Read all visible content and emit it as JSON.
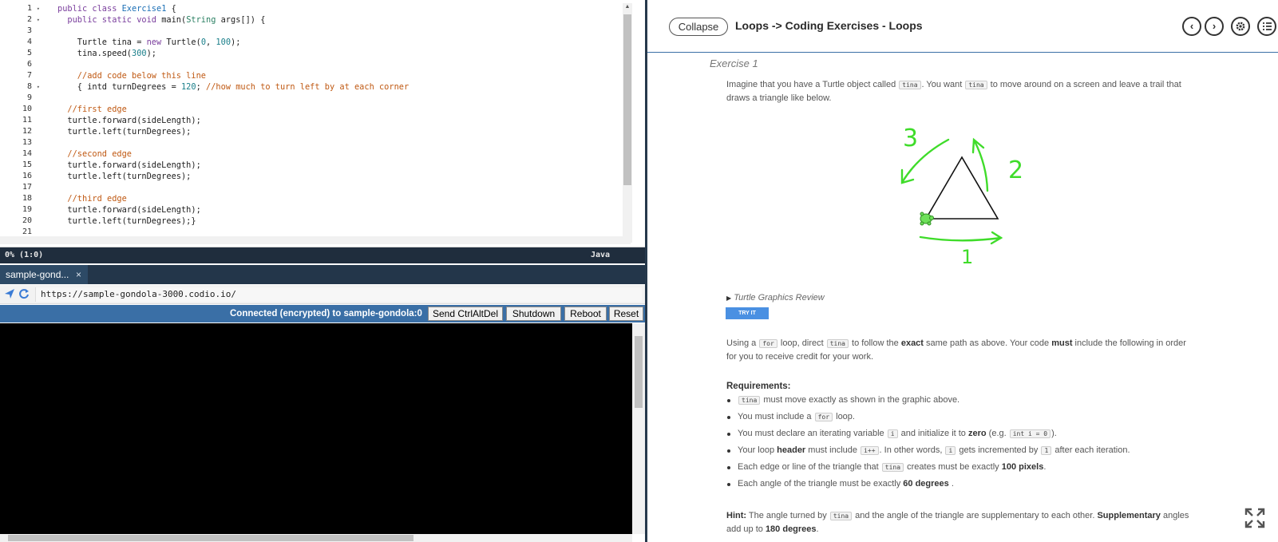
{
  "editor": {
    "lines": [
      {
        "n": "1",
        "fold": true
      },
      {
        "n": "2",
        "fold": true
      },
      {
        "n": "3"
      },
      {
        "n": "4"
      },
      {
        "n": "5"
      },
      {
        "n": "6"
      },
      {
        "n": "7"
      },
      {
        "n": "8",
        "fold": true
      },
      {
        "n": "9"
      },
      {
        "n": "10"
      },
      {
        "n": "11"
      },
      {
        "n": "12"
      },
      {
        "n": "13"
      },
      {
        "n": "14"
      },
      {
        "n": "15"
      },
      {
        "n": "16"
      },
      {
        "n": "17"
      },
      {
        "n": "18"
      },
      {
        "n": "19"
      },
      {
        "n": "20"
      },
      {
        "n": "21"
      }
    ],
    "code": [
      [
        [
          "kw",
          "public class "
        ],
        [
          "cls",
          "Exercise1"
        ],
        [
          "",
          " {"
        ]
      ],
      [
        [
          "",
          "  "
        ],
        [
          "kw",
          "public static void "
        ],
        [
          "",
          "main("
        ],
        [
          "typ",
          "String"
        ],
        [
          "",
          " args[]) {"
        ]
      ],
      [],
      [
        [
          "",
          "    Turtle tina = "
        ],
        [
          "kw",
          "new "
        ],
        [
          "",
          "Turtle("
        ],
        [
          "num",
          "0"
        ],
        [
          "",
          ", "
        ],
        [
          "num",
          "100"
        ],
        [
          "",
          ");"
        ]
      ],
      [
        [
          "",
          "    tina.speed("
        ],
        [
          "num",
          "300"
        ],
        [
          "",
          ");"
        ]
      ],
      [],
      [
        [
          "cmt",
          "    //add code below this line"
        ]
      ],
      [
        [
          "",
          "    { intd turnDegrees = "
        ],
        [
          "num",
          "120"
        ],
        [
          "",
          "; "
        ],
        [
          "cmt",
          "//how much to turn left by at each corner"
        ]
      ],
      [],
      [
        [
          "cmt",
          "  //first edge"
        ]
      ],
      [
        [
          "",
          "  turtle.forward(sideLength);"
        ]
      ],
      [
        [
          "",
          "  turtle.left(turnDegrees);"
        ]
      ],
      [],
      [
        [
          "cmt",
          "  //second edge"
        ]
      ],
      [
        [
          "",
          "  turtle.forward(sideLength);"
        ]
      ],
      [
        [
          "",
          "  turtle.left(turnDegrees);"
        ]
      ],
      [],
      [
        [
          "cmt",
          "  //third edge"
        ]
      ],
      [
        [
          "",
          "  turtle.forward(sideLength);"
        ]
      ],
      [
        [
          "",
          "  turtle.left(turnDegrees);}"
        ]
      ],
      []
    ],
    "status_position": "0%  (1:0)",
    "status_language": "Java"
  },
  "terminal": {
    "tab_label": "sample-gond...",
    "tab_close": "×",
    "url": "https://sample-gondola-3000.codio.io/",
    "connection_status": "Connected (encrypted) to sample-gondola:0",
    "buttons": {
      "send_ctrlaltdel": "Send CtrlAltDel",
      "shutdown": "Shutdown",
      "reboot": "Reboot",
      "reset": "Reset"
    }
  },
  "guide": {
    "collapse_label": "Collapse",
    "title": "Loops -> Coding Exercises - Loops",
    "exercise_title": "Exercise 1",
    "intro": {
      "t1": "Imagine that you have a Turtle object called ",
      "c1": "tina",
      "t2": ". You want ",
      "c2": "tina",
      "t3": " to move around on a screen and leave a trail that draws a triangle like below."
    },
    "figure_labels": [
      "1",
      "2",
      "3"
    ],
    "review_label": "Turtle Graphics Review",
    "try_it_label": "TRY IT",
    "instructions": {
      "t1": "Using a ",
      "c1": "for",
      "t2": " loop, direct ",
      "c2": "tina",
      "t3": " to follow the ",
      "b1": "exact",
      "t4": " same path as above. Your code ",
      "b2": "must",
      "t5": " include the following in order for you to receive credit for your work."
    },
    "requirements_heading": "Requirements:",
    "requirements": {
      "r1": {
        "c1": "tina",
        "t1": " must move exactly as shown in the graphic above."
      },
      "r2": {
        "t1": "You must include a ",
        "c1": "for",
        "t2": " loop."
      },
      "r3": {
        "t1": "You must declare an iterating variable ",
        "c1": "i",
        "t2": " and initialize it to ",
        "b1": "zero",
        "t3": " (e.g. ",
        "c2": "int i = 0",
        "t4": ")."
      },
      "r4": {
        "t1": "Your loop ",
        "b1": "header",
        "t2": " must include ",
        "c1": "i++",
        "t3": ". In other words, ",
        "c2": "i",
        "t4": " gets incremented by ",
        "c3": "1",
        "t5": " after each iteration."
      },
      "r5": {
        "t1": "Each edge or line of the triangle that ",
        "c1": "tina",
        "t2": " creates must be exactly ",
        "b1": "100 pixels",
        "t3": "."
      },
      "r6": {
        "t1": "Each angle of the triangle must be exactly ",
        "b1": "60 degrees",
        "t2": " ."
      }
    },
    "hint": {
      "b1": "Hint:",
      "t1": " The angle turned by ",
      "c1": "tina",
      "t2": " and the angle of the triangle are supplementary to each other. ",
      "b2": "Supplementary",
      "t3": " angles add up to ",
      "b3": "180 degrees",
      "t4": "."
    },
    "header_icons": [
      "chevron-left-icon",
      "chevron-right-icon",
      "gear-icon",
      "list-icon"
    ]
  },
  "colors": {
    "drawing_green": "#3fdc2a",
    "status_bar": "#1f2d3d",
    "vnc_bar": "#3a6fa6",
    "try_button": "#4a90e2"
  }
}
